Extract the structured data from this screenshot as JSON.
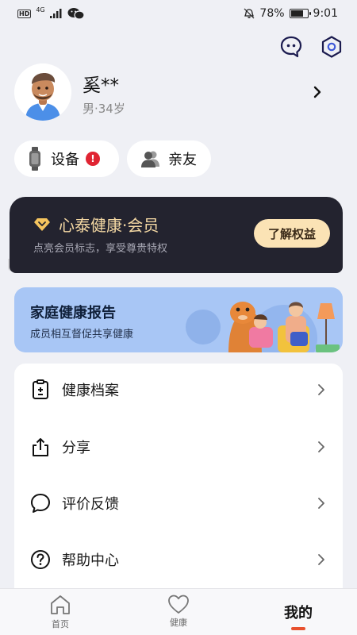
{
  "status_bar": {
    "left_badge": "HD",
    "network": "4G",
    "battery_percent": "78%",
    "battery_level": 0.78,
    "time": "9:01",
    "icons": [
      "hd-icon",
      "signal-icon",
      "wechat-icon",
      "alarm-icon",
      "battery-icon"
    ]
  },
  "top_actions": {
    "icons": [
      "message-bubble-icon",
      "settings-hexagon-icon"
    ]
  },
  "profile": {
    "name": "奚**",
    "sub": "男·34岁"
  },
  "quick_pills": {
    "device_label": "设备",
    "device_alert": "!",
    "family_label": "亲友"
  },
  "member": {
    "title": "心泰健康·会员",
    "desc": "点亮会员标志，享受尊贵特权",
    "button": "了解权益",
    "colors": {
      "card": "#23232f",
      "gold": "#f5d9a4",
      "button": "#fbe3b5"
    }
  },
  "report": {
    "title": "家庭健康报告",
    "sub": "成员相互督促共享健康",
    "color": "#a8c6f5"
  },
  "menu": {
    "items": [
      {
        "label": "健康档案",
        "icon": "health-record-icon"
      },
      {
        "label": "分享",
        "icon": "share-icon"
      },
      {
        "label": "评价反馈",
        "icon": "feedback-bubble-icon"
      },
      {
        "label": "帮助中心",
        "icon": "help-question-icon"
      }
    ]
  },
  "bottom_nav": {
    "home": "首页",
    "health": "健康",
    "me": "我的",
    "active": "我的",
    "accent": "#e8512e"
  }
}
